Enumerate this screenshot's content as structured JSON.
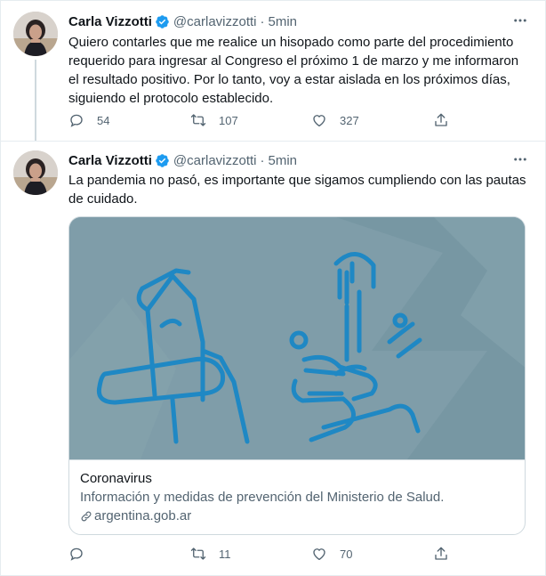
{
  "tweets": [
    {
      "author_name": "Carla Vizzotti",
      "handle": "@carlavizzotti",
      "separator": "·",
      "time": "5min",
      "text": "Quiero contarles que me realice un hisopado como parte del procedimiento requerido para ingresar al Congreso el próximo 1 de marzo y me informaron el resultado positivo. Por lo tanto, voy a estar aislada en los próximos días, siguiendo el protocolo establecido.",
      "replies": "54",
      "retweets": "107",
      "likes": "327"
    },
    {
      "author_name": "Carla Vizzotti",
      "handle": "@carlavizzotti",
      "separator": "·",
      "time": "5min",
      "text": "La pandemia no pasó, es importante que sigamos cumpliendo con las pautas de cuidado.",
      "replies": "",
      "retweets": "11",
      "likes": "70",
      "card": {
        "title": "Coronavirus",
        "description": "Información y medidas de prevención del Ministerio de Salud.",
        "domain": "argentina.gob.ar",
        "image_description_icon": "cough-into-elbow-and-handwashing-illustration"
      }
    }
  ],
  "icons": {
    "verified": "verified-badge-icon",
    "more": "more-dots-icon",
    "reply": "reply-bubble-icon",
    "retweet": "retweet-icon",
    "like": "heart-icon",
    "share": "share-upload-icon",
    "link": "link-icon"
  },
  "colors": {
    "verified_blue": "#1d9bf0",
    "text_primary": "#0f1419",
    "text_secondary": "#536471",
    "border": "#cfd9de",
    "card_image_bg": "#7f9da9",
    "card_illustration": "#1f88c4"
  }
}
